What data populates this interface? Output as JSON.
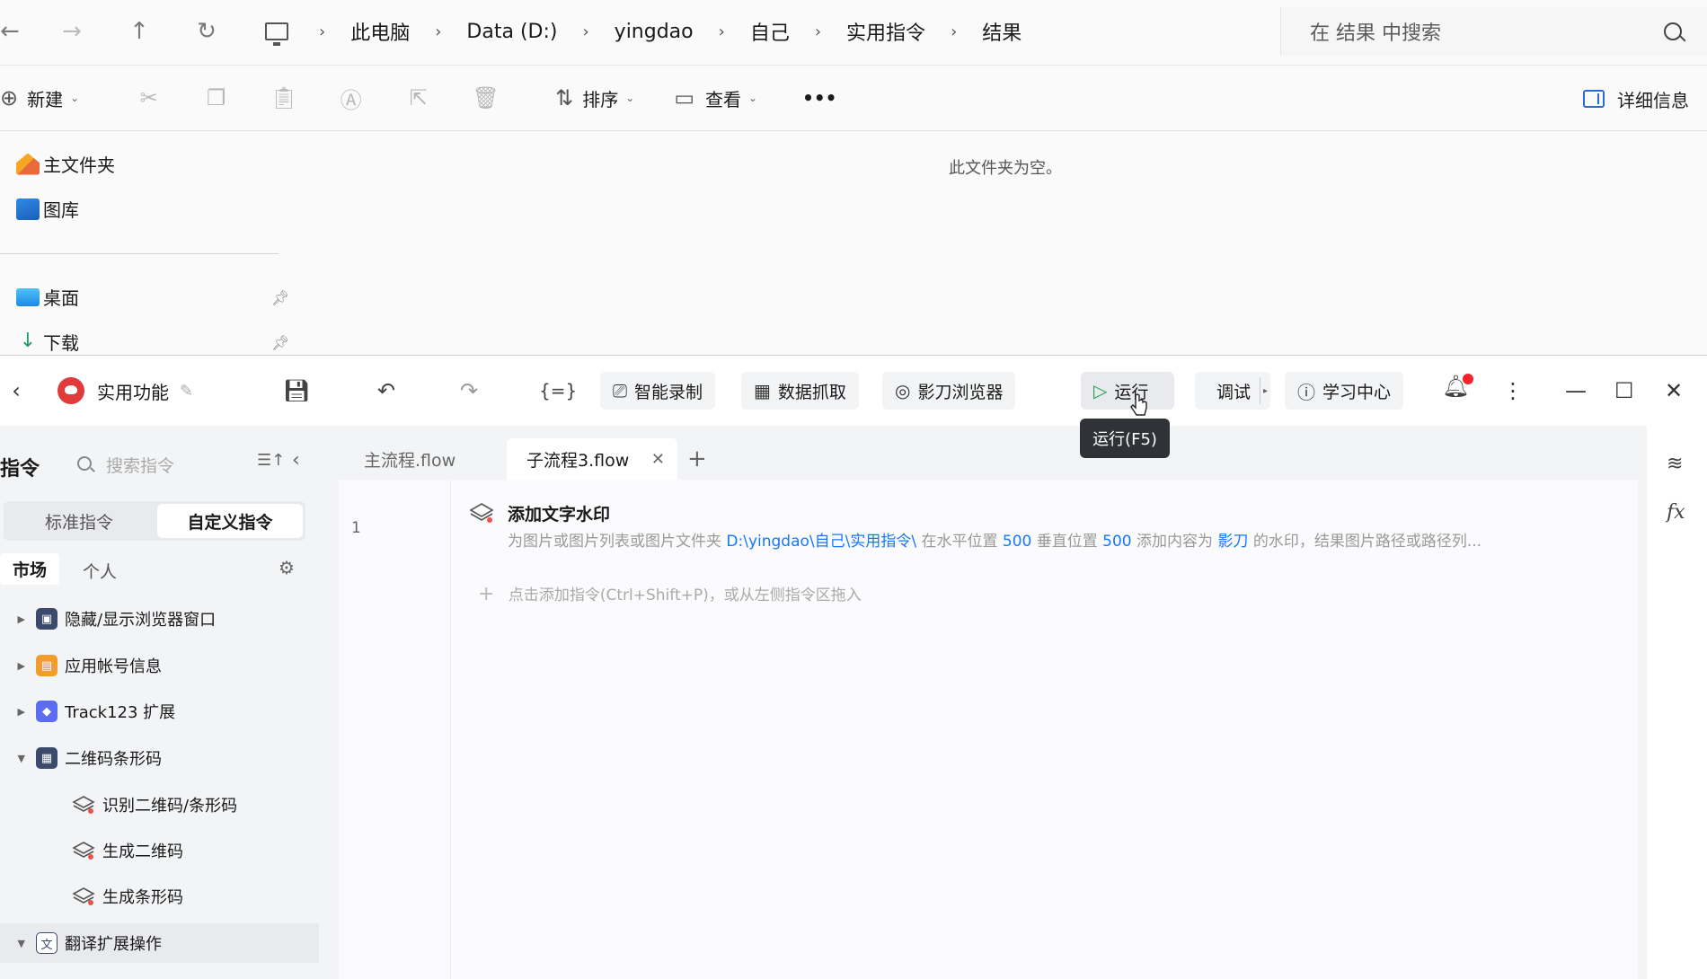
{
  "explorer": {
    "breadcrumb": [
      "此电脑",
      "Data (D:)",
      "yingdao",
      "自己",
      "实用指令",
      "结果"
    ],
    "search_placeholder": "在 结果 中搜索",
    "commands": {
      "new": "新建",
      "sort": "排序",
      "view": "查看",
      "more": "•••",
      "details": "详细信息"
    },
    "nav": {
      "home": "主文件夹",
      "gallery": "图库",
      "desktop": "桌面",
      "downloads": "下载"
    },
    "empty_message": "此文件夹为空。"
  },
  "app": {
    "project_name": "实用功能",
    "toolbar": {
      "smart_record": "智能录制",
      "data_scrape": "数据抓取",
      "browser": "影刀浏览器",
      "run": "运行",
      "debug": "调试",
      "learning": "学习中心"
    },
    "tooltip": "运行(F5)",
    "sidebar": {
      "title": "指令",
      "search_placeholder": "搜索指令",
      "segments": [
        "标准指令",
        "自定义指令"
      ],
      "tabs": [
        "市场",
        "个人"
      ],
      "items": [
        {
          "label": "隐藏/显示浏览器窗口",
          "color": "#3b4a6b",
          "glyph": "▣"
        },
        {
          "label": "应用帐号信息",
          "color": "#f39c2e",
          "glyph": "▤"
        },
        {
          "label": "Track123 扩展",
          "color": "#5b6cf0",
          "glyph": "◆"
        },
        {
          "label": "二维码条形码",
          "color": "#3b4a6b",
          "glyph": "▦"
        }
      ],
      "leaves": [
        "识别二维码/条形码",
        "生成二维码",
        "生成条形码"
      ],
      "last_item": "翻译扩展操作"
    },
    "tabs": {
      "main_flow": "主流程.flow",
      "sub_flow": "子流程3.flow"
    },
    "step": {
      "line_number": "1",
      "title": "添加文字水印",
      "desc_prefix": "为图片或图片列表或图片文件夹",
      "path": "D:\\yingdao\\自己\\实用指令\\",
      "desc_mid1": "在水平位置",
      "x": "500",
      "desc_mid2": "垂直位置",
      "y": "500",
      "desc_mid3": "添加内容为",
      "content": "影刀",
      "desc_suffix": "的水印，结果图片路径或路径列..."
    },
    "add_hint": "点击添加指令(Ctrl+Shift+P)，或从左侧指令区拖入"
  }
}
